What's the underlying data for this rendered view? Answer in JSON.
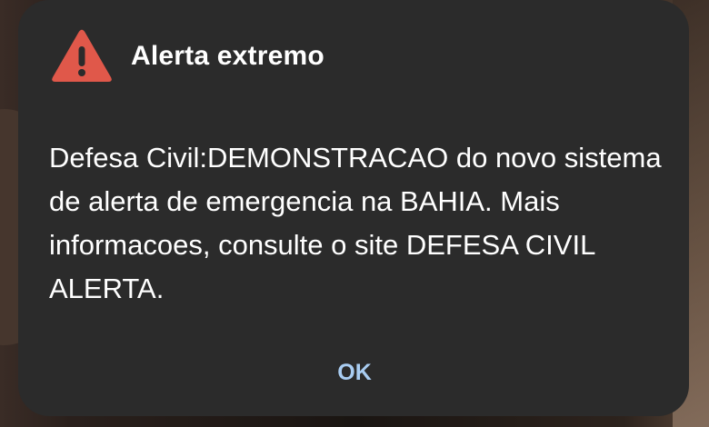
{
  "dialog": {
    "icon": "warning-triangle-icon",
    "icon_color": "#e0584a",
    "title": "Alerta extremo",
    "message": "Defesa Civil:DEMONSTRACAO do novo sistema de alerta de emergencia na BAHIA. Mais informacoes, consulte o site DEFESA CIVIL ALERTA.",
    "ok_label": "OK",
    "background_color": "#2b2b2b",
    "button_color": "#a9cdf2"
  }
}
